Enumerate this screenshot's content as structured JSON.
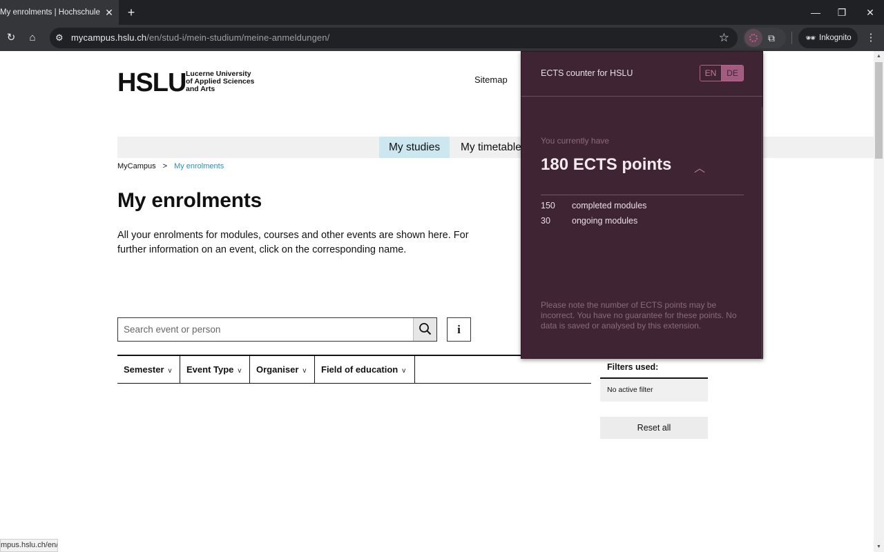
{
  "browser": {
    "tab_title": "My enrolments | Hochschule Luzern",
    "tab_close": "✕",
    "new_tab": "+",
    "window_controls": {
      "minimize": "—",
      "restore": "❐",
      "close": "✕"
    },
    "nav": {
      "reload": "↻",
      "home": "⌂"
    },
    "url": {
      "host": "mycampus.hslu.ch",
      "path": "/en/stud-i/mein-studium/meine-anmeldungen/"
    },
    "bookmark_star": "☆",
    "extension_puzzle": "⧉",
    "incognito_label": "Inkognito",
    "incognito_icon": "🕶",
    "menu": "⋮",
    "status_url": "mpus.hslu.ch/en/"
  },
  "page": {
    "logo": {
      "mark": "HSLU",
      "sub_line1": "Lucerne University",
      "sub_line2": "of Applied Sciences",
      "sub_line3": "and Arts"
    },
    "sitemap": "Sitemap",
    "nav": [
      {
        "label": "My studies",
        "active": true
      },
      {
        "label": "My timetable",
        "active": false
      }
    ],
    "breadcrumb": {
      "root": "MyCampus",
      "sep": ">",
      "current": "My enrolments"
    },
    "heading": "My enrolments",
    "intro": "All your enrolments for modules, courses and other events are shown here. For further information on an event, click on the corresponding name.",
    "search": {
      "placeholder": "Search event or person",
      "icon": "⌕"
    },
    "info_button": "i",
    "filters": [
      {
        "label": "Semester"
      },
      {
        "label": "Event Type"
      },
      {
        "label": "Organiser"
      },
      {
        "label": "Field of education"
      }
    ],
    "filter_chevron": "v",
    "filters_used": {
      "label": "Filters used:",
      "value": "No active filter"
    },
    "reset_label": "Reset all"
  },
  "popup": {
    "title": "ECTS counter for HSLU",
    "lang": {
      "en": "EN",
      "de": "DE",
      "active": "DE"
    },
    "have_label": "You currently have",
    "points": "180 ECTS points",
    "collapse_icon": "︿",
    "rows": [
      {
        "count": "150",
        "label": "completed modules"
      },
      {
        "count": "30",
        "label": "ongoing modules"
      }
    ],
    "disclaimer": "Please note the number of ECTS points may be incorrect. You have no guarantee for these points. No data is saved or analysed by this extension.",
    "colors": {
      "background": "#3f2434",
      "accent": "#a25c80"
    }
  }
}
